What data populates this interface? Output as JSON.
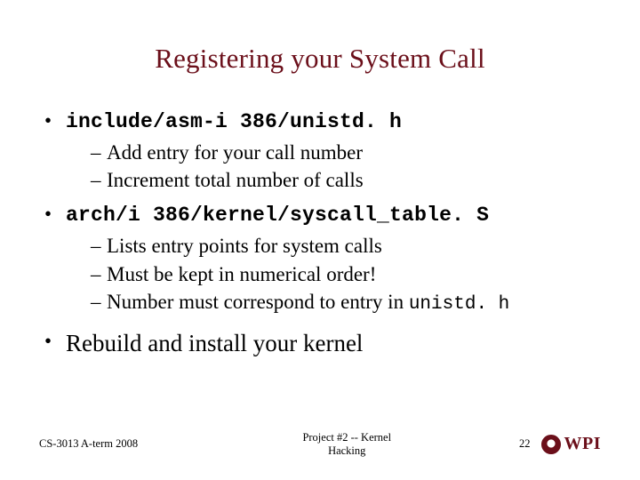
{
  "title": "Registering your System Call",
  "bullets": [
    {
      "head": "include/asm-i 386/unistd. h",
      "head_mono": true,
      "subs": [
        "Add entry for your call number",
        "Increment total number of calls"
      ]
    },
    {
      "head": "arch/i 386/kernel/syscall_table. S",
      "head_mono": true,
      "subs": [
        "Lists entry points for system calls",
        "Must be kept in numerical order!",
        "Number must correspond to entry in "
      ],
      "last_sub_tail_mono": "unistd. h"
    },
    {
      "head": "Rebuild and install your kernel",
      "big": true,
      "subs": []
    }
  ],
  "footer": {
    "left": "CS-3013 A-term 2008",
    "center_line1": "Project #2 -- Kernel",
    "center_line2": "Hacking",
    "page": "22",
    "brand": "WPI"
  }
}
